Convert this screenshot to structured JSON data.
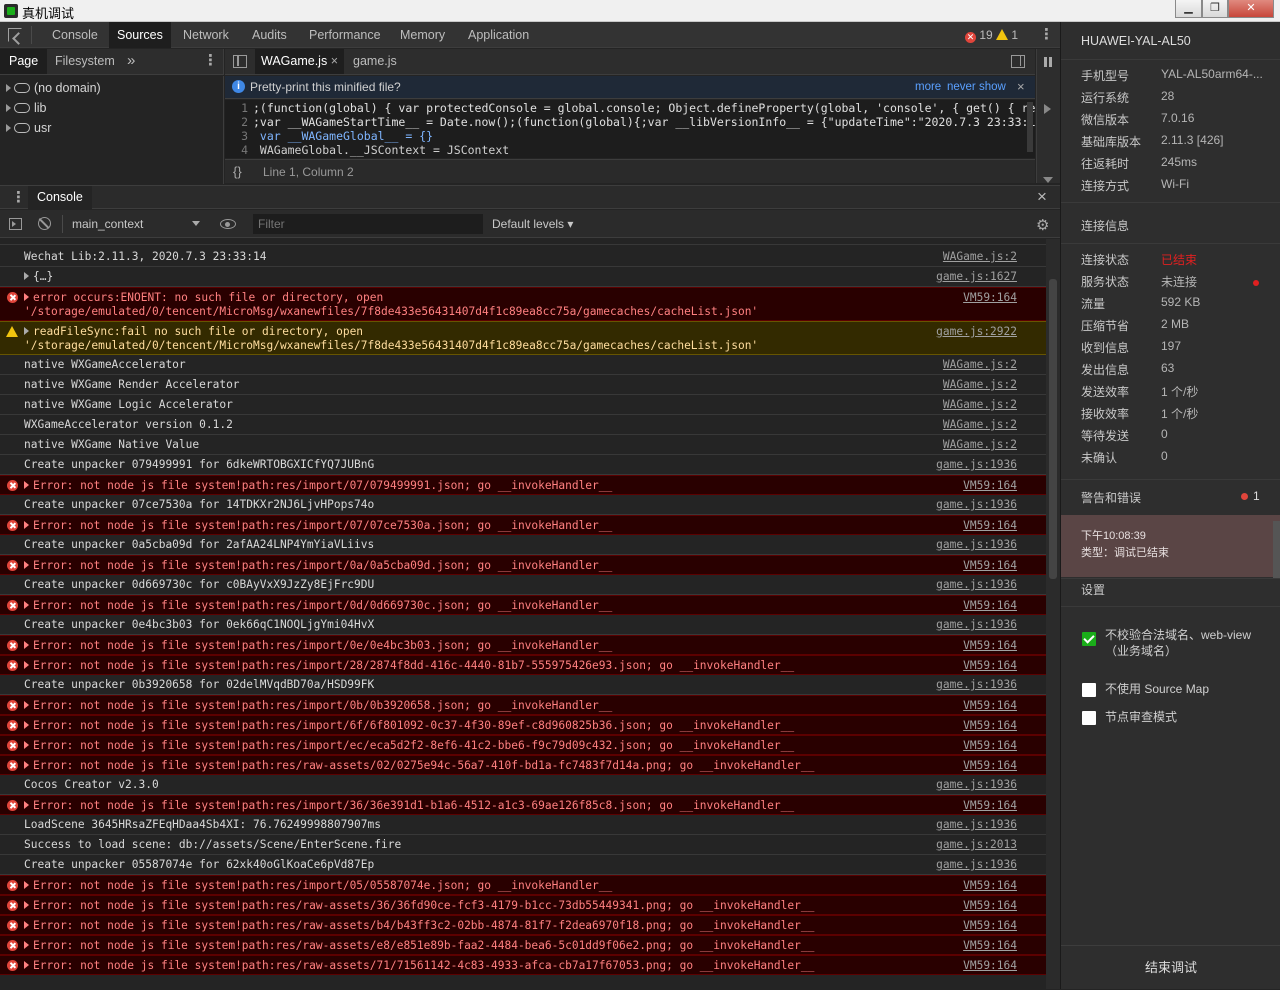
{
  "window": {
    "title": "真机调试"
  },
  "main_tabs": [
    "Console",
    "Sources",
    "Network",
    "Audits",
    "Performance",
    "Memory",
    "Application"
  ],
  "main_tab_active": "Sources",
  "counts": {
    "errors": "19",
    "warnings": "1"
  },
  "nav_tabs": [
    "Page",
    "Filesystem"
  ],
  "nav_more": "»",
  "tree": [
    "(no domain)",
    "lib",
    "usr"
  ],
  "editor_tabs": [
    {
      "label": "WAGame.js",
      "close": "×"
    },
    {
      "label": "game.js"
    }
  ],
  "pretty": {
    "text": "Pretty-print this minified file?",
    "more": "more",
    "never": "never show",
    "close": "×"
  },
  "code": [
    {
      "ln": "1",
      "text": ";(function(global) { var protectedConsole = global.console; Object.defineProperty(global, 'console', { get() { retu"
    },
    {
      "ln": "2",
      "text": ";var __WAGameStartTime__ = Date.now();(function(global){;var __libVersionInfo__ = {\"updateTime\":\"2020.7.3 23:33:14\",\""
    },
    {
      "ln": "3",
      "text": "  var __WAGameGlobal__ = {}"
    },
    {
      "ln": "4",
      "text": "    WAGameGlobal.__JSContext = JSContext"
    }
  ],
  "editor_status": {
    "braces": "{}",
    "position": "Line 1, Column 2"
  },
  "drawer": {
    "tab": "Console",
    "close": "×"
  },
  "console_toolbar": {
    "context": "main_context",
    "filter_placeholder": "Filter",
    "levels": "Default levels ▾"
  },
  "logs": [
    {
      "type": "log",
      "msg": "Wechat Lib:2.11.3, 2020.7.3 23:33:14",
      "src": "WAGame.js:2"
    },
    {
      "type": "log",
      "expand": true,
      "msg": "{…}",
      "src": "game.js:1627"
    },
    {
      "type": "error",
      "expand": true,
      "msg": "error occurs:ENOENT: no such file or directory, open\n'/storage/emulated/0/tencent/MicroMsg/wxanewfiles/7f8de433e56431407d4f1c89ea8cc75a/gamecaches/cacheList.json'",
      "src": "VM59:164"
    },
    {
      "type": "warn",
      "expand": true,
      "msg": "readFileSync:fail no such file or directory, open\n'/storage/emulated/0/tencent/MicroMsg/wxanewfiles/7f8de433e56431407d4f1c89ea8cc75a/gamecaches/cacheList.json'",
      "src": "game.js:2922"
    },
    {
      "type": "log",
      "msg": "native WXGameAccelerator",
      "src": "WAGame.js:2"
    },
    {
      "type": "log",
      "msg": "native WXGame Render Accelerator",
      "src": "WAGame.js:2"
    },
    {
      "type": "log",
      "msg": "native WXGame Logic Accelerator",
      "src": "WAGame.js:2"
    },
    {
      "type": "log",
      "msg": "WXGameAccelerator version 0.1.2",
      "src": "WAGame.js:2"
    },
    {
      "type": "log",
      "msg": "native WXGame Native Value",
      "src": "WAGame.js:2"
    },
    {
      "type": "log",
      "msg": "Create unpacker 079499991 for 6dkeWRTOBGXICfYQ7JUBnG",
      "src": "game.js:1936"
    },
    {
      "type": "error",
      "expand": true,
      "msg": "Error: not node js file system!path:res/import/07/079499991.json; go __invokeHandler__",
      "src": "VM59:164"
    },
    {
      "type": "log",
      "msg": "Create unpacker 07ce7530a for 14TDKXr2NJ6LjvHPops74o",
      "src": "game.js:1936"
    },
    {
      "type": "error",
      "expand": true,
      "msg": "Error: not node js file system!path:res/import/07/07ce7530a.json; go __invokeHandler__",
      "src": "VM59:164"
    },
    {
      "type": "log",
      "msg": "Create unpacker 0a5cba09d for 2afAA24LNP4YmYiaVLiivs",
      "src": "game.js:1936"
    },
    {
      "type": "error",
      "expand": true,
      "msg": "Error: not node js file system!path:res/import/0a/0a5cba09d.json; go __invokeHandler__",
      "src": "VM59:164"
    },
    {
      "type": "log",
      "msg": "Create unpacker 0d669730c for c0BAyVxX9JzZy8EjFrc9DU",
      "src": "game.js:1936"
    },
    {
      "type": "error",
      "expand": true,
      "msg": "Error: not node js file system!path:res/import/0d/0d669730c.json; go __invokeHandler__",
      "src": "VM59:164"
    },
    {
      "type": "log",
      "msg": "Create unpacker 0e4bc3b03 for 0ek66qC1NOQLjgYmi04HvX",
      "src": "game.js:1936"
    },
    {
      "type": "error",
      "expand": true,
      "msg": "Error: not node js file system!path:res/import/0e/0e4bc3b03.json; go __invokeHandler__",
      "src": "VM59:164"
    },
    {
      "type": "error",
      "expand": true,
      "msg": "Error: not node js file system!path:res/import/28/2874f8dd-416c-4440-81b7-555975426e93.json; go __invokeHandler__",
      "src": "VM59:164"
    },
    {
      "type": "log",
      "msg": "Create unpacker 0b3920658 for 02delMVqdBD70a/HSD99FK",
      "src": "game.js:1936"
    },
    {
      "type": "error",
      "expand": true,
      "msg": "Error: not node js file system!path:res/import/0b/0b3920658.json; go __invokeHandler__",
      "src": "VM59:164"
    },
    {
      "type": "error",
      "expand": true,
      "msg": "Error: not node js file system!path:res/import/6f/6f801092-0c37-4f30-89ef-c8d960825b36.json; go __invokeHandler__",
      "src": "VM59:164"
    },
    {
      "type": "error",
      "expand": true,
      "msg": "Error: not node js file system!path:res/import/ec/eca5d2f2-8ef6-41c2-bbe6-f9c79d09c432.json; go __invokeHandler__",
      "src": "VM59:164"
    },
    {
      "type": "error",
      "expand": true,
      "msg": "Error: not node js file system!path:res/raw-assets/02/0275e94c-56a7-410f-bd1a-fc7483f7d14a.png; go __invokeHandler__",
      "src": "VM59:164"
    },
    {
      "type": "log",
      "msg": "Cocos Creator v2.3.0",
      "src": "game.js:1936"
    },
    {
      "type": "error",
      "expand": true,
      "msg": "Error: not node js file system!path:res/import/36/36e391d1-b1a6-4512-a1c3-69ae126f85c8.json; go __invokeHandler__",
      "src": "VM59:164"
    },
    {
      "type": "log",
      "msg": "LoadScene 3645HRsaZFEqHDaa4Sb4XI: 76.76249998807907ms",
      "src": "game.js:1936"
    },
    {
      "type": "log",
      "msg": "Success to load scene: db://assets/Scene/EnterScene.fire",
      "src": "game.js:2013"
    },
    {
      "type": "log",
      "msg": "Create unpacker 05587074e for 62xk40oGlKoaCe6pVd87Ep",
      "src": "game.js:1936"
    },
    {
      "type": "error",
      "expand": true,
      "msg": "Error: not node js file system!path:res/import/05/05587074e.json; go __invokeHandler__",
      "src": "VM59:164"
    },
    {
      "type": "error",
      "expand": true,
      "msg": "Error: not node js file system!path:res/raw-assets/36/36fd90ce-fcf3-4179-b1cc-73db55449341.png; go __invokeHandler__",
      "src": "VM59:164"
    },
    {
      "type": "error",
      "expand": true,
      "msg": "Error: not node js file system!path:res/raw-assets/b4/b43ff3c2-02bb-4874-81f7-f2dea6970f18.png; go __invokeHandler__",
      "src": "VM59:164"
    },
    {
      "type": "error",
      "expand": true,
      "msg": "Error: not node js file system!path:res/raw-assets/e8/e851e89b-faa2-4484-bea6-5c01dd9f06e2.png; go __invokeHandler__",
      "src": "VM59:164"
    },
    {
      "type": "error",
      "expand": true,
      "msg": "Error: not node js file system!path:res/raw-assets/71/71561142-4c83-4933-afca-cb7a17f67053.png; go __invokeHandler__",
      "src": "VM59:164"
    }
  ],
  "right_panel": {
    "device": "HUAWEI-YAL-AL50",
    "info": [
      {
        "label": "手机型号",
        "value": "YAL-AL50arm64-..."
      },
      {
        "label": "运行系统",
        "value": "28"
      },
      {
        "label": "微信版本",
        "value": "7.0.16"
      },
      {
        "label": "基础库版本",
        "value": "2.11.3 [426]"
      },
      {
        "label": "往返耗时",
        "value": "245ms"
      },
      {
        "label": "连接方式",
        "value": "Wi-Fi"
      }
    ],
    "conn_title": "连接信息",
    "conn": [
      {
        "label": "连接状态",
        "value": "已结束",
        "color": "#e02020"
      },
      {
        "label": "服务状态",
        "value": "未连接"
      },
      {
        "label": "流量",
        "value": "592 KB"
      },
      {
        "label": "压缩节省",
        "value": "2 MB"
      },
      {
        "label": "收到信息",
        "value": "197"
      },
      {
        "label": "发出信息",
        "value": "63"
      },
      {
        "label": "发送效率",
        "value": "1 个/秒"
      },
      {
        "label": "接收效率",
        "value": "1 个/秒"
      },
      {
        "label": "等待发送",
        "value": "0"
      },
      {
        "label": "未确认",
        "value": "0"
      }
    ],
    "warn_title": "警告和错误",
    "warn_count": "1",
    "event_time": "下午10:08:39",
    "event_type": "类型：调试已结束",
    "settings_title": "设置",
    "settings": [
      {
        "label": "不校验合法域名、web-view（业务域名）",
        "checked": true
      },
      {
        "label": "不使用 Source Map",
        "checked": false
      },
      {
        "label": "节点审查模式",
        "checked": false
      }
    ],
    "end_button": "结束调试"
  }
}
